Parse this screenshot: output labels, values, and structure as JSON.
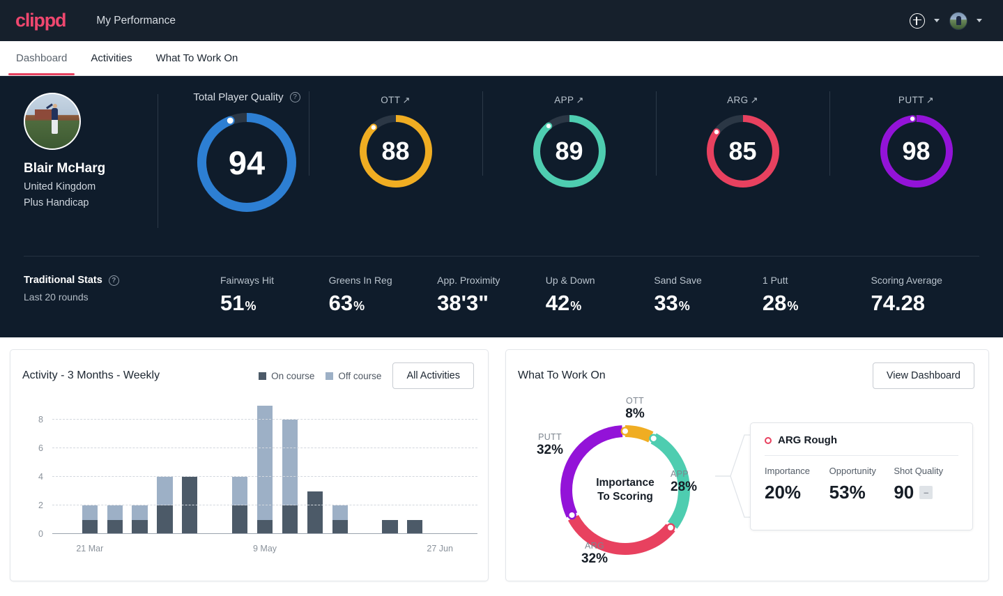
{
  "topbar": {
    "logo": "clippd",
    "title": "My Performance",
    "add_icon": "plus-circle-icon",
    "chevron_icon": "chevron-down-icon"
  },
  "tabs": [
    {
      "label": "Dashboard",
      "active": true
    },
    {
      "label": "Activities",
      "active": false
    },
    {
      "label": "What To Work On",
      "active": false
    }
  ],
  "player": {
    "name": "Blair McHarg",
    "country": "United Kingdom",
    "handicap": "Plus Handicap"
  },
  "quality": {
    "heading": "Total Player Quality",
    "help_icon": "question-circle-icon",
    "total": {
      "label": "Total Player Quality",
      "value": "94",
      "color": "#2d7fd3",
      "percent": 94
    },
    "metrics": [
      {
        "label": "OTT",
        "trend": "↗",
        "value": "88",
        "color": "#f0ad22",
        "percent": 88
      },
      {
        "label": "APP",
        "trend": "↗",
        "value": "89",
        "color": "#4ecdb0",
        "percent": 89
      },
      {
        "label": "ARG",
        "trend": "↗",
        "value": "85",
        "color": "#e8415f",
        "percent": 85
      },
      {
        "label": "PUTT",
        "trend": "↗",
        "value": "98",
        "color": "#9313d8",
        "percent": 98
      }
    ]
  },
  "traditional": {
    "title": "Traditional Stats",
    "help_icon": "question-circle-icon",
    "subtitle": "Last 20 rounds",
    "stats": [
      {
        "label": "Fairways Hit",
        "value": "51",
        "unit": "%"
      },
      {
        "label": "Greens In Reg",
        "value": "63",
        "unit": "%"
      },
      {
        "label": "App. Proximity",
        "value": "38'3\"",
        "unit": ""
      },
      {
        "label": "Up & Down",
        "value": "42",
        "unit": "%"
      },
      {
        "label": "Sand Save",
        "value": "33",
        "unit": "%"
      },
      {
        "label": "1 Putt",
        "value": "28",
        "unit": "%"
      },
      {
        "label": "Scoring Average",
        "value": "74.28",
        "unit": ""
      }
    ]
  },
  "activity": {
    "title": "Activity - 3 Months - Weekly",
    "legend": [
      {
        "label": "On course",
        "color": "#4c5a68"
      },
      {
        "label": "Off course",
        "color": "#9db0c6"
      }
    ],
    "button": "All Activities"
  },
  "chart_data": {
    "type": "bar",
    "title": "Activity - 3 Months - Weekly",
    "stacked": true,
    "xlabel": "",
    "ylabel": "",
    "ylim": [
      0,
      9
    ],
    "yticks": [
      0,
      2,
      4,
      6,
      8
    ],
    "grid": true,
    "legend_position": "top-right",
    "tick_labels": [
      {
        "index": 1,
        "label": "21 Mar"
      },
      {
        "index": 8,
        "label": "9 May"
      },
      {
        "index": 15,
        "label": "27 Jun"
      }
    ],
    "categories": [
      "w1",
      "w2",
      "w3",
      "w4",
      "w5",
      "w6",
      "w7",
      "w8",
      "w9",
      "w10",
      "w11",
      "w12",
      "w13",
      "w14",
      "w15",
      "w16",
      "w17"
    ],
    "series": [
      {
        "name": "On course",
        "color": "#4c5a68",
        "values": [
          0,
          1,
          1,
          1,
          2,
          4,
          0,
          2,
          1,
          2,
          3,
          1,
          0,
          1,
          1,
          0,
          0
        ]
      },
      {
        "name": "Off course",
        "color": "#9db0c6",
        "values": [
          0,
          1,
          1,
          1,
          2,
          0,
          0,
          2,
          8,
          6,
          0,
          1,
          0,
          0,
          0,
          0,
          0
        ]
      }
    ]
  },
  "wtwo": {
    "title": "What To Work On",
    "button": "View Dashboard",
    "donut": {
      "center_line1": "Importance",
      "center_line2": "To Scoring",
      "segments": [
        {
          "name": "OTT",
          "percent": "8%",
          "value": 8,
          "color": "#f0ad22"
        },
        {
          "name": "APP",
          "percent": "28%",
          "value": 28,
          "color": "#4ecdb0"
        },
        {
          "name": "ARG",
          "percent": "32%",
          "value": 32,
          "color": "#e8415f"
        },
        {
          "name": "PUTT",
          "percent": "32%",
          "value": 32,
          "color": "#9313d8"
        }
      ]
    },
    "detail": {
      "title": "ARG Rough",
      "marker_icon": "ring-dot-icon",
      "marker_color": "#e8415f",
      "columns": [
        {
          "label": "Importance",
          "value": "20%"
        },
        {
          "label": "Opportunity",
          "value": "53%"
        },
        {
          "label": "Shot Quality",
          "value": "90",
          "trend": "–"
        }
      ]
    }
  }
}
